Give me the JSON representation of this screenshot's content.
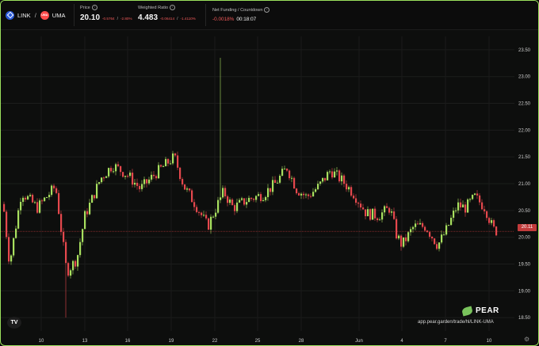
{
  "pair": {
    "base": "LINK",
    "separator": "/",
    "quote": "UMA",
    "quote_icon_text": "UMA"
  },
  "price": {
    "label": "Price",
    "value": "20.10",
    "change_abs": "-0.5764",
    "slash": "/",
    "change_pct": "-2.80%"
  },
  "weighted_ratio": {
    "label": "Weighted Ratio",
    "value": "4.483",
    "change_abs": "-0.06414",
    "slash": "/",
    "change_pct": "-1.4110%"
  },
  "net_funding": {
    "label": "Net Funding / Countdown",
    "rate": "-0.0018%",
    "countdown": "00:18:07"
  },
  "brand": {
    "name": "PEAR",
    "url": "app.pear.garden/trade/hl/LINK-UMA",
    "tv_logo": "TV"
  },
  "colors": {
    "up": "#a8e05f",
    "down": "#e5484d",
    "accent": "#9be15d"
  },
  "chart_data": {
    "type": "candlestick",
    "y_ticks": [
      "23.50",
      "23.00",
      "22.50",
      "22.00",
      "21.50",
      "21.00",
      "20.50",
      "20.00",
      "19.50",
      "19.00",
      "18.50"
    ],
    "ylim": [
      18.25,
      23.75
    ],
    "x_ticks": [
      "10",
      "13",
      "16",
      "19",
      "22",
      "25",
      "28",
      "Jun",
      "4",
      "7",
      "10"
    ],
    "last_price_label": "20.11",
    "grid": true
  }
}
